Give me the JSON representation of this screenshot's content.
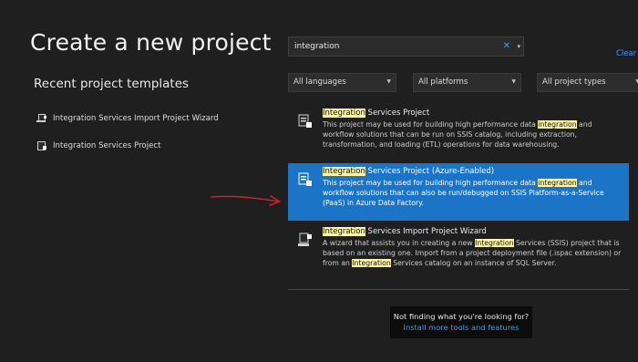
{
  "title": "Create a new project",
  "recent": {
    "heading": "Recent project templates",
    "items": [
      {
        "label": "Integration Services Import Project Wizard"
      },
      {
        "label": "Integration Services Project"
      }
    ]
  },
  "search": {
    "value": "integration",
    "clear_glyph": "✕",
    "dropdown_glyph": "▾",
    "clear_all_label": "Clear"
  },
  "filters": [
    {
      "label": "All languages"
    },
    {
      "label": "All platforms"
    },
    {
      "label": "All project types"
    }
  ],
  "results": [
    {
      "title_hl": "Integration",
      "title_rest": " Services Project",
      "desc": {
        "p1": "This project may be used for building high performance data ",
        "hl1": "integration",
        "p2": " and workflow solutions that can be run on SSIS catalog, including extraction, transformation, and loading (ETL) operations for data warehousing."
      }
    },
    {
      "title_hl": "Integration",
      "title_rest": " Services Project (Azure-Enabled)",
      "desc": {
        "p1": "This project may be used for building high performance data ",
        "hl1": "integration",
        "p2": " and workflow solutions that can also be run/debugged on SSIS Platform-as-a-Service (PaaS) in Azure Data Factory."
      }
    },
    {
      "title_hl": "Integration",
      "title_rest": " Services Import Project Wizard",
      "desc": {
        "p1": "A wizard that assists you in creating a new ",
        "hl1": "Integration",
        "p2": " Services (SSIS) project that is based on an existing one. Import from a project deployment file (.ispac extension) or from an ",
        "hl2": "Integration",
        "p3": " Services catalog on an instance of SQL Server."
      }
    }
  ],
  "help": {
    "text": "Not finding what you're looking for?",
    "link": "Install more tools and features"
  },
  "colors": {
    "selected": "#1c74c6",
    "accent_link": "#3e9cff",
    "highlight": "#fff7a8",
    "annotation_arrow": "#c0262c"
  }
}
